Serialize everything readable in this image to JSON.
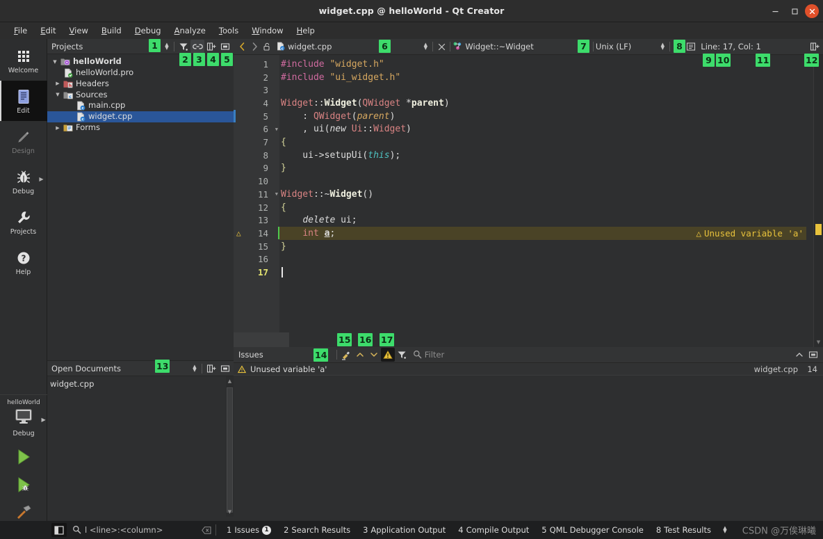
{
  "window": {
    "title": "widget.cpp @ helloWorld - Qt Creator",
    "minimize_label": "–",
    "maximize_label": "□",
    "close_label": "✕"
  },
  "menubar": {
    "items": [
      {
        "label": "File",
        "accel": "F"
      },
      {
        "label": "Edit",
        "accel": "E"
      },
      {
        "label": "View",
        "accel": "V"
      },
      {
        "label": "Build",
        "accel": "B"
      },
      {
        "label": "Debug",
        "accel": "D"
      },
      {
        "label": "Analyze",
        "accel": "A"
      },
      {
        "label": "Tools",
        "accel": "T"
      },
      {
        "label": "Window",
        "accel": "W"
      },
      {
        "label": "Help",
        "accel": "H"
      }
    ]
  },
  "modebar": {
    "items": [
      {
        "label": "Welcome",
        "icon": "grid-icon",
        "active": false,
        "disabled": false,
        "has_arrow": false
      },
      {
        "label": "Edit",
        "icon": "document-lines-icon",
        "active": true,
        "disabled": false,
        "has_arrow": false
      },
      {
        "label": "Design",
        "icon": "pencil-icon",
        "active": false,
        "disabled": true,
        "has_arrow": false
      },
      {
        "label": "Debug",
        "icon": "bug-icon",
        "active": false,
        "disabled": false,
        "has_arrow": true
      },
      {
        "label": "Projects",
        "icon": "wrench-icon",
        "active": false,
        "disabled": false,
        "has_arrow": false
      },
      {
        "label": "Help",
        "icon": "question-circle-icon",
        "active": false,
        "disabled": false,
        "has_arrow": false
      }
    ],
    "kit_selector": {
      "project": "helloWorld",
      "build_config": "Debug",
      "icon": "monitor-icon",
      "run_label": "Run",
      "debug_label": "Start Debugging",
      "build_label": "Build Project"
    }
  },
  "projects_panel": {
    "title": "Projects",
    "toolbar": [
      {
        "name": "filter-icon",
        "callout": "2"
      },
      {
        "name": "link-sync-icon",
        "callout": "3"
      },
      {
        "name": "split-add-icon",
        "callout": "4"
      },
      {
        "name": "close-panel-icon",
        "callout": "5"
      }
    ],
    "selector_callout": "1",
    "tree": [
      {
        "label": "helloWorld",
        "indent": 0,
        "twist": "down",
        "icon": "project-icon",
        "bold": true,
        "selected": false
      },
      {
        "label": "helloWorld.pro",
        "indent": 1,
        "twist": "none",
        "icon": "pro-file-icon",
        "bold": false,
        "selected": false
      },
      {
        "label": "Headers",
        "indent": 1,
        "twist": "right",
        "icon": "headers-folder-icon",
        "bold": false,
        "selected": false
      },
      {
        "label": "Sources",
        "indent": 1,
        "twist": "down",
        "icon": "sources-folder-icon",
        "bold": false,
        "selected": false
      },
      {
        "label": "main.cpp",
        "indent": 2,
        "twist": "none",
        "icon": "cpp-file-icon",
        "bold": false,
        "selected": false
      },
      {
        "label": "widget.cpp",
        "indent": 2,
        "twist": "none",
        "icon": "cpp-file-icon",
        "bold": false,
        "selected": true
      },
      {
        "label": "Forms",
        "indent": 1,
        "twist": "right",
        "icon": "forms-folder-icon",
        "bold": false,
        "selected": false
      }
    ]
  },
  "open_documents": {
    "title": "Open Documents",
    "callout": "13",
    "items": [
      "widget.cpp"
    ]
  },
  "editor_toolbar": {
    "back_icon": "chevron-left-icon",
    "forward_icon": "chevron-right-icon",
    "lock_icon": "unlocked-icon",
    "file_icon": "cpp-file-icon",
    "file_name": "widget.cpp",
    "file_callout": "6",
    "close_icon": "close-icon",
    "symbol_icon": "symbol-icon",
    "symbol_name": "Widget::~Widget",
    "symbol_callout": "7",
    "line_ending": "Unix (LF)",
    "line_ending_callout": "8",
    "split_icon": "split-editor-icon",
    "split_callout": "9",
    "outline_icon": "outline-icon",
    "outline_callout": "10",
    "cursor_position": "Line: 17, Col: 1",
    "cursor_callout": "11",
    "split_add_icon": "split-add-icon",
    "split_add_callout": "12"
  },
  "code": {
    "cursor_line": 17,
    "warning_line": 14,
    "fold_lines": [
      6,
      11
    ],
    "warning_message": "Unused variable 'a'",
    "lines": [
      {
        "n": 1,
        "tokens": [
          {
            "t": "#include ",
            "c": "k-pre"
          },
          {
            "t": "\"widget.h\"",
            "c": "k-str"
          }
        ]
      },
      {
        "n": 2,
        "tokens": [
          {
            "t": "#include ",
            "c": "k-pre"
          },
          {
            "t": "\"ui_widget.h\"",
            "c": "k-str"
          }
        ]
      },
      {
        "n": 3,
        "tokens": []
      },
      {
        "n": 4,
        "tokens": [
          {
            "t": "Widget",
            "c": "k-typ"
          },
          {
            "t": "::",
            "c": "k-punc"
          },
          {
            "t": "Widget",
            "c": "k-bold"
          },
          {
            "t": "(",
            "c": "k-punc"
          },
          {
            "t": "QWidget",
            "c": "k-typ"
          },
          {
            "t": " *",
            "c": "k-punc"
          },
          {
            "t": "parent",
            "c": "k-bold"
          },
          {
            "t": ")",
            "c": "k-punc"
          }
        ]
      },
      {
        "n": 5,
        "tokens": [
          {
            "t": "    : ",
            "c": "k-punc"
          },
          {
            "t": "QWidget",
            "c": "k-typ"
          },
          {
            "t": "(",
            "c": "k-punc"
          },
          {
            "t": "parent",
            "c": "k-param"
          },
          {
            "t": ")",
            "c": "k-punc"
          }
        ]
      },
      {
        "n": 6,
        "tokens": [
          {
            "t": "    , ",
            "c": "k-punc"
          },
          {
            "t": "ui",
            "c": "k-pln"
          },
          {
            "t": "(",
            "c": "k-punc"
          },
          {
            "t": "new",
            "c": "k-itkw"
          },
          {
            "t": " ",
            "c": "k-pln"
          },
          {
            "t": "Ui",
            "c": "k-typ"
          },
          {
            "t": "::",
            "c": "k-punc"
          },
          {
            "t": "Widget",
            "c": "k-typ"
          },
          {
            "t": ")",
            "c": "k-punc"
          }
        ]
      },
      {
        "n": 7,
        "tokens": [
          {
            "t": "{",
            "c": "k-brace"
          }
        ]
      },
      {
        "n": 8,
        "tokens": [
          {
            "t": "    ui",
            "c": "k-pln"
          },
          {
            "t": "->",
            "c": "k-punc"
          },
          {
            "t": "setupUi",
            "c": "k-pln"
          },
          {
            "t": "(",
            "c": "k-punc"
          },
          {
            "t": "this",
            "c": "k-this"
          },
          {
            "t": ");",
            "c": "k-punc"
          }
        ]
      },
      {
        "n": 9,
        "tokens": [
          {
            "t": "}",
            "c": "k-brace"
          }
        ]
      },
      {
        "n": 10,
        "tokens": []
      },
      {
        "n": 11,
        "tokens": [
          {
            "t": "Widget",
            "c": "k-typ"
          },
          {
            "t": "::~",
            "c": "k-punc"
          },
          {
            "t": "Widget",
            "c": "k-bold"
          },
          {
            "t": "()",
            "c": "k-punc"
          }
        ]
      },
      {
        "n": 12,
        "tokens": [
          {
            "t": "{",
            "c": "k-brace"
          }
        ]
      },
      {
        "n": 13,
        "tokens": [
          {
            "t": "    ",
            "c": "k-pln"
          },
          {
            "t": "delete",
            "c": "k-itkw"
          },
          {
            "t": " ui;",
            "c": "k-pln"
          }
        ]
      },
      {
        "n": 14,
        "tokens": [
          {
            "t": "    ",
            "c": "k-pln"
          },
          {
            "t": "int",
            "c": "k-kw"
          },
          {
            "t": " ",
            "c": "k-pln"
          },
          {
            "t": "a",
            "c": "k-local"
          },
          {
            "t": ";",
            "c": "k-punc"
          }
        ]
      },
      {
        "n": 15,
        "tokens": [
          {
            "t": "}",
            "c": "k-brace"
          }
        ]
      },
      {
        "n": 16,
        "tokens": []
      },
      {
        "n": 17,
        "tokens": []
      }
    ]
  },
  "issues_panel": {
    "title": "Issues",
    "title_callout": "14",
    "toolbar": [
      {
        "name": "clear-icon",
        "callout": "15"
      },
      {
        "name": "chevron-up-icon",
        "callout": ""
      },
      {
        "name": "chevron-down-icon",
        "callout": "16"
      },
      {
        "name": "warning-filter-icon",
        "callout": "17"
      },
      {
        "name": "filter-icon",
        "callout": ""
      }
    ],
    "filter_placeholder": "Filter",
    "collapse_icon": "chevron-up-icon",
    "maximize_icon": "maximize-panel-icon",
    "rows": [
      {
        "severity": "warning",
        "message": "Unused variable 'a'",
        "file": "widget.cpp",
        "line": "14"
      }
    ]
  },
  "statusbar": {
    "sidebar_toggle_icon": "sidebar-toggle-icon",
    "locator_icon": "search-icon",
    "locator_placeholder": "l <line>:<column>",
    "locator_clear_icon": "clear-input-icon",
    "outputs": [
      {
        "key": "1",
        "label": "Issues",
        "badge": "1"
      },
      {
        "key": "2",
        "label": "Search Results",
        "badge": ""
      },
      {
        "key": "3",
        "label": "Application Output",
        "badge": ""
      },
      {
        "key": "4",
        "label": "Compile Output",
        "badge": ""
      },
      {
        "key": "5",
        "label": "QML Debugger Console",
        "badge": ""
      },
      {
        "key": "8",
        "label": "Test Results",
        "badge": ""
      }
    ],
    "more_icon": "updown-arrows-icon",
    "watermark": "CSDN @万俟琳曦"
  },
  "colors": {
    "accent_green": "#3ddc6b",
    "selection_blue": "#2a5699",
    "warning_yellow": "#e8c23c",
    "warning_bg": "#4a4326",
    "editor_bg": "#2e2f30",
    "gutter_bg": "#353637",
    "chrome_bg": "#333435"
  }
}
